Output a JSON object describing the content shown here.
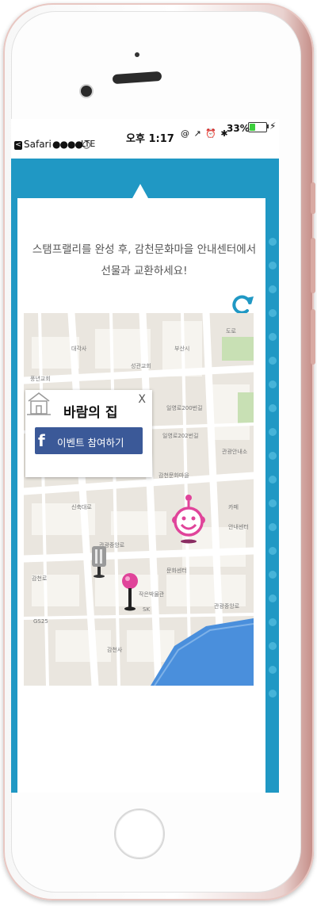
{
  "status_bar": {
    "back_glyph": "<",
    "carrier": "Safari",
    "signal_dots": "●●●●○",
    "network": "LTE",
    "time": "오후 1:17",
    "icons": "@ ↗ ⏰ ✱",
    "battery_percent": "33%",
    "battery_level": 0.33,
    "charge_glyph": "⚡"
  },
  "content": {
    "instruction_line1": "스탬프랠리를 완성 후, 감천문화마을 안내센터에서",
    "instruction_line2": "선물과 교환하세요!",
    "refresh_icon": "refresh-icon"
  },
  "map": {
    "labels": [
      "대각사",
      "성관교회",
      "부산시",
      "도로",
      "풍년교회",
      "일영로200번길",
      "일영로202번길",
      "관광안내소",
      "감천문화마을",
      "카페",
      "안내센터",
      "신축대로",
      "관광중앙로",
      "감천로",
      "작은박물관",
      "문화센터",
      "감천사",
      "GS25",
      "SK",
      "관광중앙로"
    ],
    "popup": {
      "title": "바람의 집",
      "close": "X",
      "facebook_letter": "f",
      "facebook_button": "이벤트 참여하기"
    }
  },
  "colors": {
    "accent": "#2098c4",
    "facebook": "#3b5998",
    "pin": "#e0449a",
    "map_bg": "#eae6df",
    "water": "#4a8fdc"
  },
  "scroll_top_icon": "chevron-up-icon"
}
